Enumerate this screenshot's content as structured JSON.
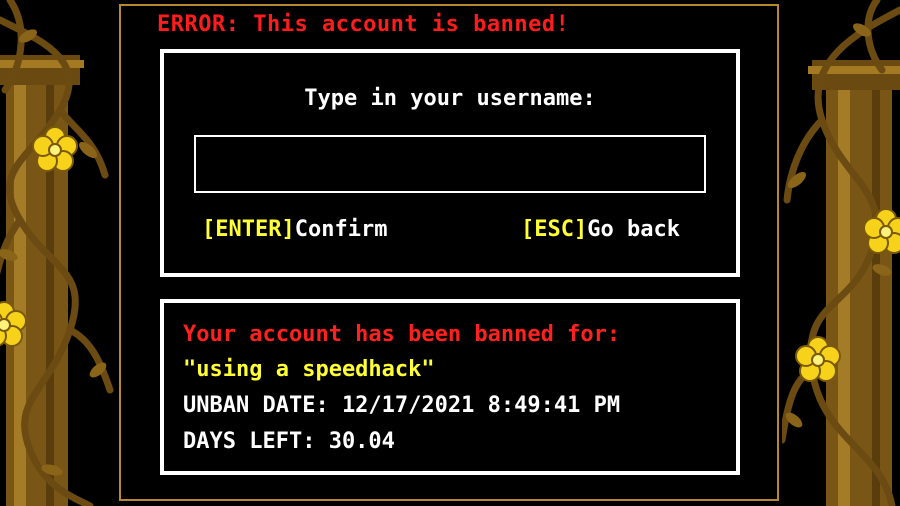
{
  "error": {
    "title": "ERROR: This account is banned!"
  },
  "login": {
    "prompt": "Type in your username:",
    "username_value": "",
    "confirm_key": "[ENTER]",
    "confirm_label": "Confirm",
    "back_key": "[ESC]",
    "back_label": "Go back"
  },
  "ban": {
    "heading": "Your account has been banned for:",
    "reason": "\"using a speedhack\"",
    "unban_date": "UNBAN DATE: 12/17/2021 8:49:41 PM",
    "days_left": "DAYS LEFT: 30.04"
  },
  "colors": {
    "error_red": "#ff1c1c",
    "key_yellow": "#ffff33",
    "panel_border": "#ffffff",
    "frame_gold": "#b8892a",
    "flower_yellow": "#f7d21a"
  },
  "decor": {
    "left_icons": [
      "pillar-icon",
      "vine-icon",
      "golden-flower-icon"
    ],
    "right_icons": [
      "pillar-icon",
      "vine-icon",
      "golden-flower-icon"
    ]
  }
}
